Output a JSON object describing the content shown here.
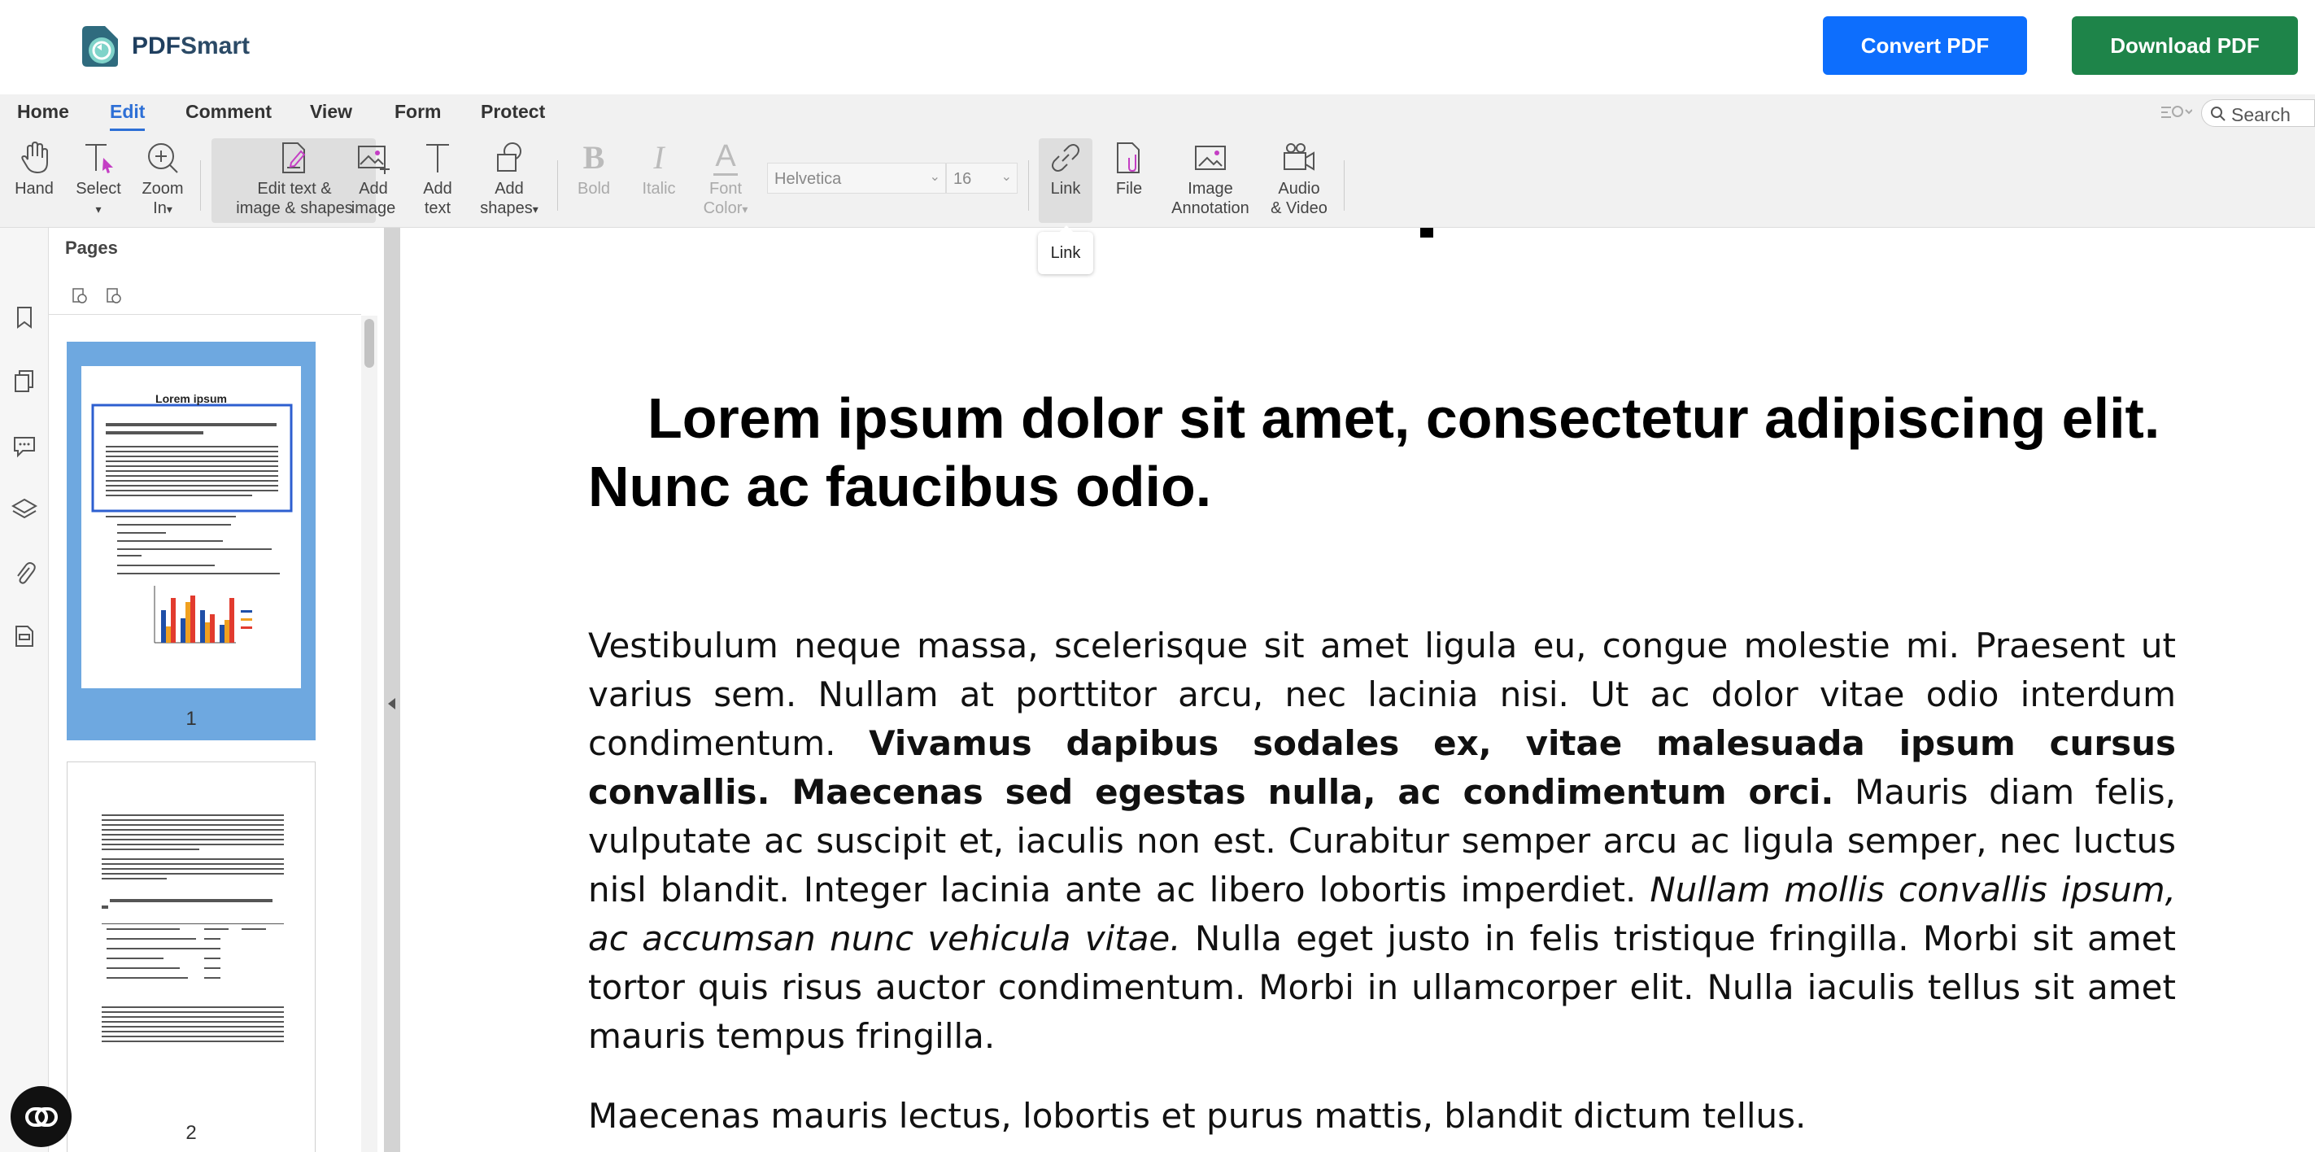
{
  "header": {
    "logo_text_pdf": "PDF",
    "logo_text_smart": "Smart",
    "convert_label": "Convert PDF",
    "download_label": "Download PDF"
  },
  "menu": {
    "items": [
      "Home",
      "Edit",
      "Comment",
      "View",
      "Form",
      "Protect"
    ],
    "active": "Edit",
    "search_placeholder": "Search"
  },
  "toolbar": {
    "hand": "Hand",
    "select": "Select",
    "zoom_in_1": "Zoom",
    "zoom_in_2": "In",
    "edit_1": "Edit text &",
    "edit_2": "image & shapes",
    "add_image_1": "Add",
    "add_image_2": "image",
    "add_text_1": "Add",
    "add_text_2": "text",
    "add_shapes_1": "Add",
    "add_shapes_2": "shapes",
    "bold": "Bold",
    "italic": "Italic",
    "font_color_1": "Font",
    "font_color_2": "Color",
    "font_family": "Helvetica",
    "font_size": "16",
    "link": "Link",
    "file": "File",
    "image_annotation_1": "Image",
    "image_annotation_2": "Annotation",
    "audio_video_1": "Audio",
    "audio_video_2": "& Video",
    "tooltip": "Link"
  },
  "pages_panel": {
    "title": "Pages",
    "page_numbers": [
      "1",
      "2"
    ],
    "thumb1_title": "Lorem ipsum"
  },
  "document": {
    "heading": "Lorem ipsum dolor sit amet, consectetur adipiscing elit. Nunc ac faucibus odio.",
    "p1_a": "Vestibulum neque massa, scelerisque sit amet ligula eu, congue molestie mi. Praesent ut varius sem. Nullam at porttitor arcu, nec lacinia nisi. Ut ac dolor vitae odio interdum condimentum. ",
    "p1_bold": "Vivamus dapibus sodales ex, vitae malesuada ipsum cursus convallis. Maecenas sed egestas nulla, ac condimentum orci.",
    "p1_b": " Mauris diam felis, vulputate ac suscipit et, iaculis non est. Curabitur semper arcu ac ligula semper, nec luctus nisl blandit. Integer lacinia ante ac libero lobortis imperdiet. ",
    "p1_italic": "Nullam mollis convallis ipsum, ac accumsan nunc vehicula vitae.",
    "p1_c": " Nulla eget justo in felis tristique fringilla. Morbi sit amet tortor quis risus auctor condimentum. Morbi in ullamcorper elit. Nulla iaculis tellus sit amet mauris tempus fringilla.",
    "p2": "Maecenas mauris lectus, lobortis et purus mattis, blandit dictum tellus."
  },
  "colors": {
    "convert": "#0d6efd",
    "download": "#1e8449",
    "active_tab": "#2d6fd6",
    "thumb_selected": "#6ea8e0"
  }
}
